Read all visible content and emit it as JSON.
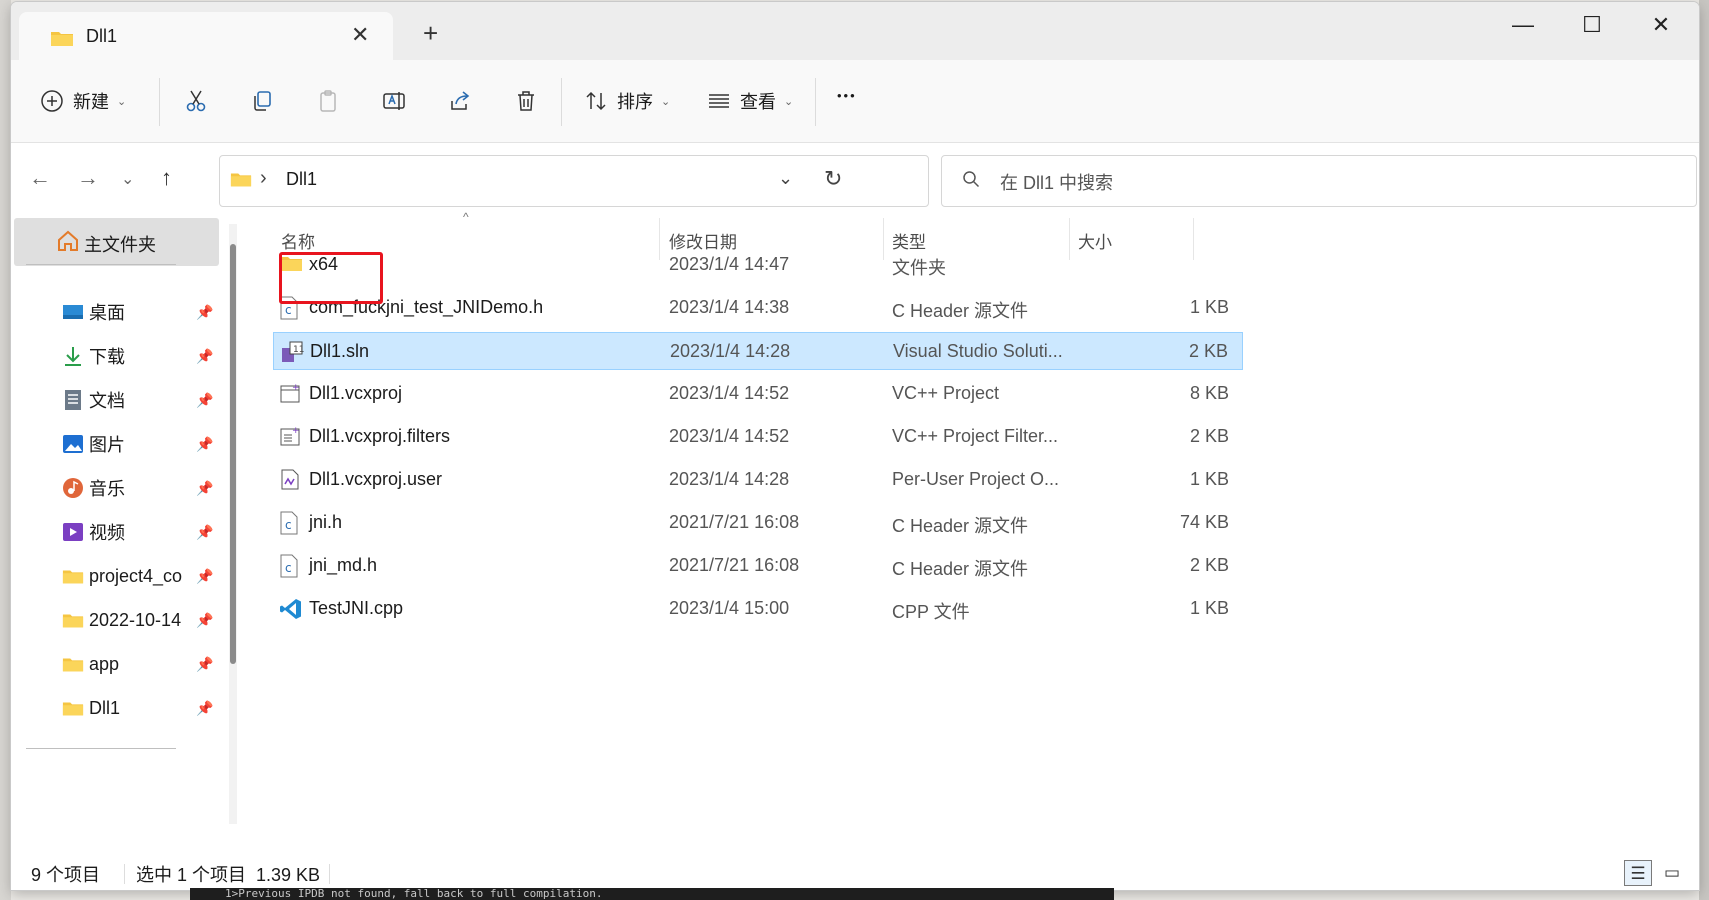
{
  "window": {
    "tab_title": "Dll1",
    "tab_close": "✕",
    "new_tab": "+",
    "minimize": "—",
    "maximize": "☐",
    "close": "✕"
  },
  "toolbar": {
    "new_label": "新建",
    "sort_label": "排序",
    "view_label": "查看",
    "more_label": "•••"
  },
  "address": {
    "path_sep": "›",
    "path": "Dll1",
    "search_placeholder": "在 Dll1 中搜索"
  },
  "sidebar": {
    "home": "主文件夹",
    "items": [
      {
        "label": "桌面",
        "icon": "desktop-icon",
        "color": "#2a8ad4"
      },
      {
        "label": "下载",
        "icon": "download-icon",
        "color": "#2a9d4a"
      },
      {
        "label": "文档",
        "icon": "document-icon",
        "color": "#6c7a89"
      },
      {
        "label": "图片",
        "icon": "pictures-icon",
        "color": "#1e6fd1"
      },
      {
        "label": "音乐",
        "icon": "music-icon",
        "color": "#e0663a"
      },
      {
        "label": "视频",
        "icon": "video-icon",
        "color": "#7b3fc2"
      },
      {
        "label": "project4_co",
        "icon": "folder-icon",
        "color": "#f5c542"
      },
      {
        "label": "2022-10-14",
        "icon": "folder-icon",
        "color": "#f5c542"
      },
      {
        "label": "app",
        "icon": "folder-icon",
        "color": "#f5c542"
      },
      {
        "label": "Dll1",
        "icon": "folder-icon",
        "color": "#f5c542"
      }
    ]
  },
  "columns": {
    "name": "名称",
    "date": "修改日期",
    "type": "类型",
    "size": "大小"
  },
  "files": [
    {
      "name": "x64",
      "date": "2023/1/4 14:47",
      "type": "文件夹",
      "size": "",
      "icon": "folder-icon"
    },
    {
      "name": "com_fuckjni_test_JNIDemo.h",
      "date": "2023/1/4 14:38",
      "type": "C Header 源文件",
      "size": "1 KB",
      "icon": "c-header-icon"
    },
    {
      "name": "Dll1.sln",
      "date": "2023/1/4 14:28",
      "type": "Visual Studio Soluti...",
      "size": "2 KB",
      "icon": "vs-solution-icon"
    },
    {
      "name": "Dll1.vcxproj",
      "date": "2023/1/4 14:52",
      "type": "VC++ Project",
      "size": "8 KB",
      "icon": "vcxproj-icon"
    },
    {
      "name": "Dll1.vcxproj.filters",
      "date": "2023/1/4 14:52",
      "type": "VC++ Project Filter...",
      "size": "2 KB",
      "icon": "filters-icon"
    },
    {
      "name": "Dll1.vcxproj.user",
      "date": "2023/1/4 14:28",
      "type": "Per-User Project O...",
      "size": "1 KB",
      "icon": "user-project-icon"
    },
    {
      "name": "jni.h",
      "date": "2021/7/21 16:08",
      "type": "C Header 源文件",
      "size": "74 KB",
      "icon": "c-header-icon"
    },
    {
      "name": "jni_md.h",
      "date": "2021/7/21 16:08",
      "type": "C Header 源文件",
      "size": "2 KB",
      "icon": "c-header-icon"
    },
    {
      "name": "TestJNI.cpp",
      "date": "2023/1/4 15:00",
      "type": "CPP 文件",
      "size": "1 KB",
      "icon": "vscode-icon"
    }
  ],
  "status": {
    "count": "9 个项目",
    "selected": "选中 1 个项目  1.39 KB"
  },
  "console_text": "1>Previous IPDB not found, fall back to full compilation."
}
